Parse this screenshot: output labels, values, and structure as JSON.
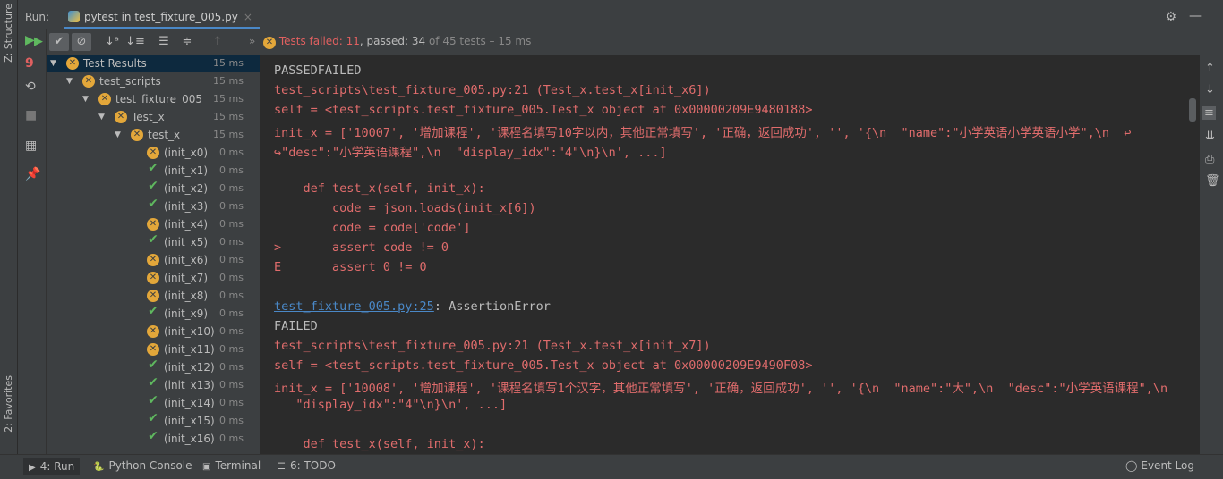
{
  "left_strip": {
    "structure_label": "Z: Structure",
    "favorites_label": "2: Favorites"
  },
  "run_header": {
    "label": "Run:",
    "tab_title": "pytest in test_fixture_005.py"
  },
  "status": {
    "failed_text": "Tests failed: 11",
    "passed_text": ", passed: 34",
    "total_text": " of 45 tests – 15 ms"
  },
  "tree": [
    {
      "name": "Test Results",
      "time": "15 ms",
      "status": "fail",
      "depth": 0,
      "expanded": true,
      "selected": true
    },
    {
      "name": "test_scripts",
      "time": "15 ms",
      "status": "fail",
      "depth": 1,
      "expanded": true
    },
    {
      "name": "test_fixture_005",
      "time": "15 ms",
      "status": "fail",
      "depth": 2,
      "expanded": true
    },
    {
      "name": "Test_x",
      "time": "15 ms",
      "status": "fail",
      "depth": 3,
      "expanded": true
    },
    {
      "name": "test_x",
      "time": "15 ms",
      "status": "fail",
      "depth": 4,
      "expanded": true
    },
    {
      "name": "(init_x0)",
      "time": "0 ms",
      "status": "fail",
      "depth": 5
    },
    {
      "name": "(init_x1)",
      "time": "0 ms",
      "status": "pass",
      "depth": 5
    },
    {
      "name": "(init_x2)",
      "time": "0 ms",
      "status": "pass",
      "depth": 5
    },
    {
      "name": "(init_x3)",
      "time": "0 ms",
      "status": "pass",
      "depth": 5
    },
    {
      "name": "(init_x4)",
      "time": "0 ms",
      "status": "fail",
      "depth": 5
    },
    {
      "name": "(init_x5)",
      "time": "0 ms",
      "status": "pass",
      "depth": 5
    },
    {
      "name": "(init_x6)",
      "time": "0 ms",
      "status": "fail",
      "depth": 5
    },
    {
      "name": "(init_x7)",
      "time": "0 ms",
      "status": "fail",
      "depth": 5
    },
    {
      "name": "(init_x8)",
      "time": "0 ms",
      "status": "fail",
      "depth": 5
    },
    {
      "name": "(init_x9)",
      "time": "0 ms",
      "status": "pass",
      "depth": 5
    },
    {
      "name": "(init_x10)",
      "time": "0 ms",
      "status": "fail",
      "depth": 5
    },
    {
      "name": "(init_x11)",
      "time": "0 ms",
      "status": "fail",
      "depth": 5
    },
    {
      "name": "(init_x12)",
      "time": "0 ms",
      "status": "pass",
      "depth": 5
    },
    {
      "name": "(init_x13)",
      "time": "0 ms",
      "status": "pass",
      "depth": 5
    },
    {
      "name": "(init_x14)",
      "time": "0 ms",
      "status": "pass",
      "depth": 5
    },
    {
      "name": "(init_x15)",
      "time": "0 ms",
      "status": "pass",
      "depth": 5
    },
    {
      "name": "(init_x16)",
      "time": "0 ms",
      "status": "pass",
      "depth": 5
    }
  ],
  "console": [
    {
      "text": "PASSEDFAILED",
      "kind": "plain"
    },
    {
      "text": "test_scripts\\test_fixture_005.py:21 (Test_x.test_x[init_x6])",
      "kind": "error"
    },
    {
      "text": "self = <test_scripts.test_fixture_005.Test_x object at 0x00000209E9480188>",
      "kind": "error"
    },
    {
      "text": "init_x = ['10007', '增加课程', '课程名填写10字以内，其他正常填写', '正确，返回成功', '', '{\\n  \"name\":\"小学英语小学英语小学\",\\n  ↩",
      "kind": "error"
    },
    {
      "text": "↪\"desc\":\"小学英语课程\",\\n  \"display_idx\":\"4\"\\n}\\n', ...]",
      "kind": "error"
    },
    {
      "text": "",
      "kind": "error"
    },
    {
      "text": "    def test_x(self, init_x):",
      "kind": "error"
    },
    {
      "text": "        code = json.loads(init_x[6])",
      "kind": "error"
    },
    {
      "text": "        code = code['code']",
      "kind": "error"
    },
    {
      "text": ">       assert code != 0",
      "kind": "error"
    },
    {
      "text": "E       assert 0 != 0",
      "kind": "error"
    },
    {
      "text": "",
      "kind": "error"
    },
    {
      "text": "test_fixture_005.py:25",
      "suffix": ": AssertionError",
      "kind": "link"
    },
    {
      "text": "FAILED",
      "kind": "plain"
    },
    {
      "text": "test_scripts\\test_fixture_005.py:21 (Test_x.test_x[init_x7])",
      "kind": "error"
    },
    {
      "text": "self = <test_scripts.test_fixture_005.Test_x object at 0x00000209E9490F08>",
      "kind": "error"
    },
    {
      "text": "init_x = ['10008', '增加课程', '课程名填写1个汉字，其他正常填写', '正确，返回成功', '', '{\\n  \"name\":\"大\",\\n  \"desc\":\"小学英语课程\",\\n",
      "kind": "error"
    },
    {
      "text": "   \"display_idx\":\"4\"\\n}\\n', ...]",
      "kind": "error"
    },
    {
      "text": "",
      "kind": "error"
    },
    {
      "text": "    def test_x(self, init_x):",
      "kind": "error"
    }
  ],
  "bottom_tabs": [
    {
      "label": "4: Run",
      "active": true,
      "icon": "play-icon"
    },
    {
      "label": "Python Console",
      "icon": "python-icon"
    },
    {
      "label": "Terminal",
      "icon": "terminal-icon"
    },
    {
      "label": "6: TODO",
      "icon": "todo-icon"
    }
  ],
  "event_log": "Event Log",
  "colors": {
    "error": "#e06c6c",
    "link": "#4a88c7",
    "fail_badge": "#e3a73a",
    "pass": "#5fb85f",
    "console_bg": "#2b2b2b"
  }
}
